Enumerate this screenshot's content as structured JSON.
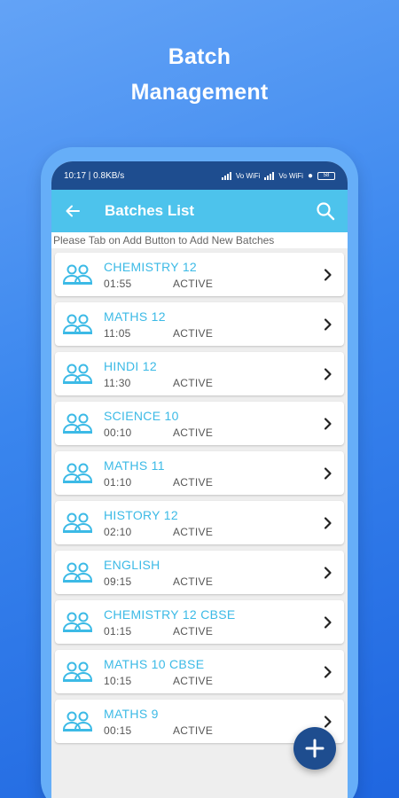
{
  "hero": {
    "line1": "Batch",
    "line2": "Management"
  },
  "status_bar": {
    "time_speed": "10:17 | 0.8KB/s",
    "volte1": "Vo WiFi",
    "volte2": "Vo WiFi",
    "battery": "58"
  },
  "app_bar": {
    "title": "Batches List",
    "back_icon": "arrow-left-icon",
    "search_icon": "search-icon"
  },
  "hint": "Please Tab on Add Button to Add New Batches",
  "batches": [
    {
      "name": "CHEMISTRY 12",
      "time": "01:55",
      "status": "ACTIVE"
    },
    {
      "name": "MATHS 12",
      "time": "11:05",
      "status": "ACTIVE"
    },
    {
      "name": "HINDI 12",
      "time": "11:30",
      "status": "ACTIVE"
    },
    {
      "name": "SCIENCE 10",
      "time": "00:10",
      "status": "ACTIVE"
    },
    {
      "name": "MATHS 11",
      "time": "01:10",
      "status": "ACTIVE"
    },
    {
      "name": "HISTORY 12",
      "time": "02:10",
      "status": "ACTIVE"
    },
    {
      "name": "ENGLISH",
      "time": "09:15",
      "status": "ACTIVE"
    },
    {
      "name": "CHEMISTRY  12 CBSE",
      "time": "01:15",
      "status": "ACTIVE"
    },
    {
      "name": "MATHS 10 CBSE",
      "time": "10:15",
      "status": "ACTIVE"
    },
    {
      "name": "MATHS 9",
      "time": "00:15",
      "status": "ACTIVE"
    }
  ],
  "fab_icon": "plus-icon",
  "colors": {
    "status_bar": "#1e4d8f",
    "app_bar": "#4dc3ec",
    "accent": "#3cbae6",
    "fab": "#1e4d8f"
  }
}
